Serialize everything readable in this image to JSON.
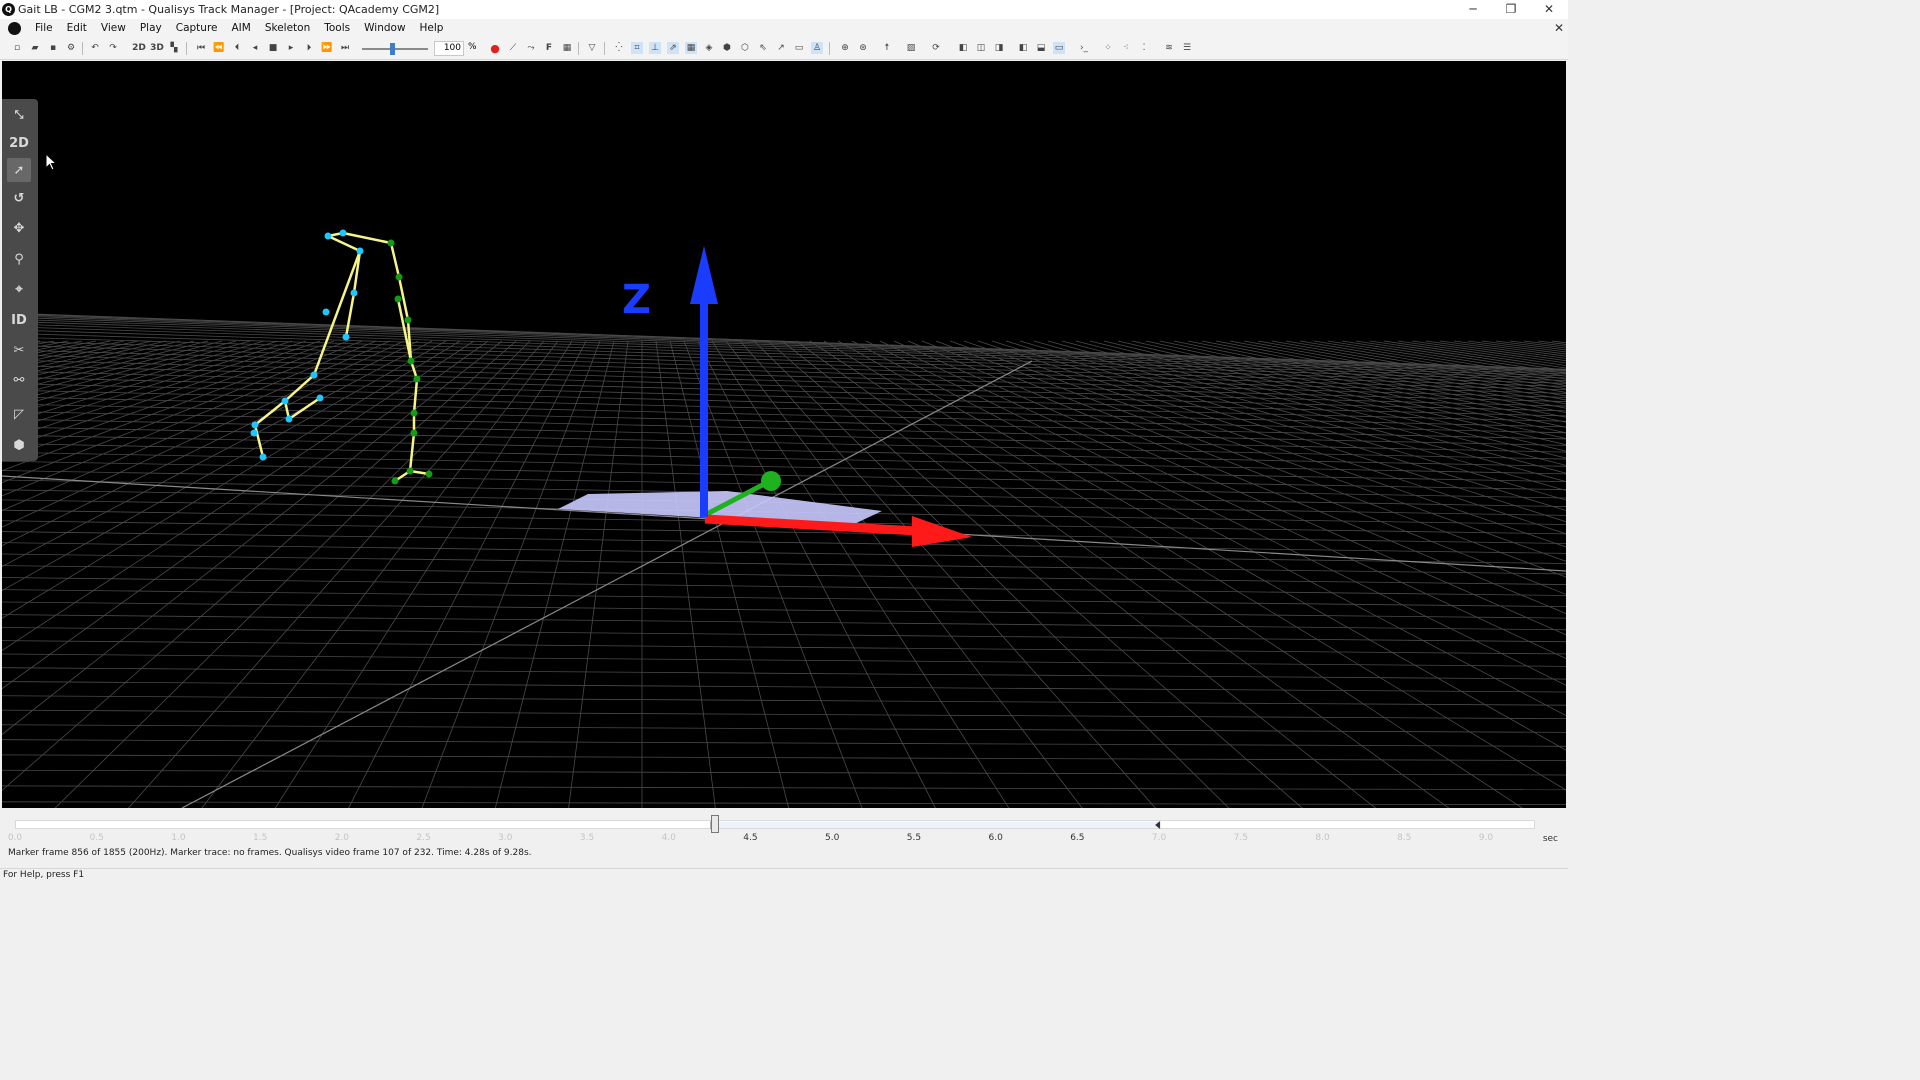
{
  "window": {
    "title": "Gait LB - CGM2 3.qtm - Qualisys Track Manager - [Project: QAcademy CGM2]",
    "minimize": "─",
    "restore": "❐",
    "close": "✕"
  },
  "menu": {
    "items": [
      "File",
      "Edit",
      "View",
      "Play",
      "Capture",
      "AIM",
      "Skeleton",
      "Tools",
      "Window",
      "Help"
    ],
    "mdi_close": "✕"
  },
  "toolbar": {
    "label_2d": "2D",
    "label_3d": "3D",
    "label_f": "F",
    "speed_value": "100",
    "speed_unit": "%",
    "speed_fraction": 0.45,
    "accent_color": "#3d7ec5",
    "record_color": "#e02020"
  },
  "tools": {
    "mode_2d": "2D",
    "id": "ID",
    "icons": [
      "arrow-icon",
      "rotate-icon",
      "translate-icon",
      "zoom-icon",
      "center-icon",
      "identify-icon",
      "cut-icon",
      "bone-icon",
      "select-trajectory-icon",
      "cube-icon"
    ]
  },
  "scene": {
    "axis_label": "Z",
    "axis_colors": {
      "x": "#ff1a1a",
      "y": "#1fb21f",
      "z": "#1a3cff"
    },
    "left_leg_marker_color": "#1ec8ff",
    "right_leg_marker_color": "#169b16",
    "bone_color": "#f5f58a",
    "floor_plate_color": "#c9c9ff"
  },
  "timeline": {
    "ticks": [
      "0.0",
      "0.5",
      "1.0",
      "1.5",
      "2.0",
      "2.5",
      "3.0",
      "3.5",
      "4.0",
      "4.5",
      "5.0",
      "5.5",
      "6.0",
      "6.5",
      "7.0",
      "7.5",
      "8.0",
      "8.5",
      "9.0"
    ],
    "unit": "sec",
    "current_time_s": 4.28,
    "total_time_s": 9.28,
    "range_start_s": 4.25,
    "range_end_s": 7.0,
    "info": "Marker frame 856 of 1855 (200Hz). Marker trace: no frames. Qualisys video frame 107 of 232. Time: 4.28s of 9.28s."
  },
  "statusbar": {
    "help": "For Help, press F1"
  }
}
